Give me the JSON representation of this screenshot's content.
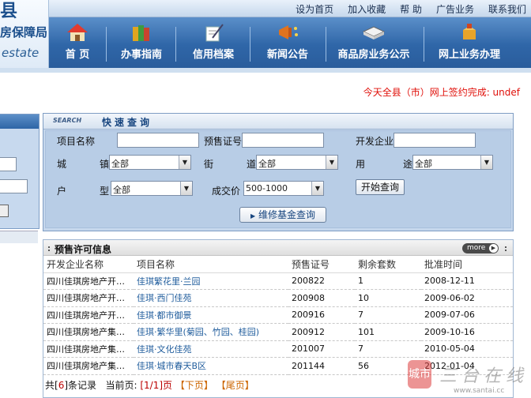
{
  "logo": {
    "line1": "县",
    "line2": "房保障局",
    "line3": "estate"
  },
  "toplinks": [
    "设为首页",
    "加入收藏",
    "帮 助",
    "广告业务",
    "联系我们"
  ],
  "nav": [
    "首 页",
    "办事指南",
    "信用档案",
    "新闻公告",
    "商品房业务公示",
    "网上业务办理"
  ],
  "bulletin": "今天全县（市）网上签约完成: undef",
  "quicksearch": {
    "badge": "SEARCH",
    "title": "快速查询",
    "project_label": "项目名称",
    "permit_label": "预售证号",
    "developer_label": "开发企业",
    "city_label1": "城",
    "city_label2": "镇",
    "city_value": "全部",
    "street_label1": "街",
    "street_label2": "道",
    "street_value": "全部",
    "use_label1": "用",
    "use_label2": "途",
    "use_value": "全部",
    "type_label1": "户",
    "type_label2": "型",
    "type_value": "全部",
    "price_label": "成交价",
    "price_value": "500-1000",
    "search_button": "开始查询",
    "fund_button": "维修基金查询"
  },
  "presale": {
    "title": "预售许可信息",
    "more": "more",
    "columns": [
      "开发企业名称",
      "项目名称",
      "预售证号",
      "剩余套数",
      "批准时间"
    ],
    "rows": [
      {
        "company": "四川佳琪房地产开…",
        "project": "佳琪繁花里·兰园",
        "permit": "200822",
        "remaining": "1",
        "date": "2008-12-11"
      },
      {
        "company": "四川佳琪房地产开…",
        "project": "佳琪·西门佳苑",
        "permit": "200908",
        "remaining": "10",
        "date": "2009-06-02"
      },
      {
        "company": "四川佳琪房地产开…",
        "project": "佳琪·都市御景",
        "permit": "200916",
        "remaining": "7",
        "date": "2009-07-06"
      },
      {
        "company": "四川佳琪房地产集…",
        "project": "佳琪·繁华里(菊园、竹园、桂园)",
        "permit": "200912",
        "remaining": "101",
        "date": "2009-10-16"
      },
      {
        "company": "四川佳琪房地产集…",
        "project": "佳琪·文化佳苑",
        "permit": "201007",
        "remaining": "7",
        "date": "2010-05-04"
      },
      {
        "company": "四川佳琪房地产集…",
        "project": "佳琪·城市春天B区",
        "permit": "201144",
        "remaining": "56",
        "date": "2012-01-04"
      }
    ],
    "pager": {
      "total_prefix": "共[",
      "total": "6",
      "total_suffix": "]条记录",
      "current_label": "当前页:",
      "current": "[1/1]页",
      "next": "【下页】",
      "last": "【尾页】"
    }
  },
  "watermark": {
    "badge": "城市",
    "text": "三台在线",
    "url": "www.santai.cc"
  }
}
